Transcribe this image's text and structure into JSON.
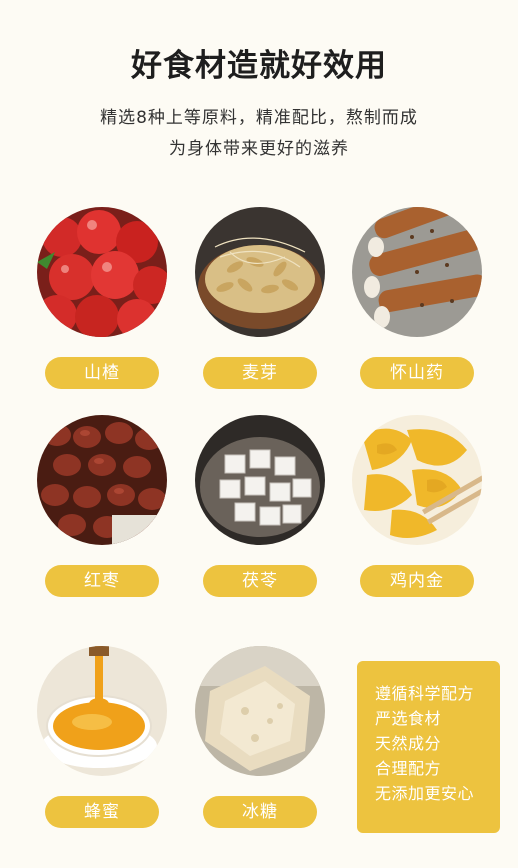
{
  "header": {
    "title": "好食材造就好效用",
    "subtitle_line1": "精选8种上等原料，精准配比，熬制而成",
    "subtitle_line2": "为身体带来更好的滋养"
  },
  "ingredients": [
    {
      "label": "山楂",
      "icon": "hawthorn"
    },
    {
      "label": "麦芽",
      "icon": "malt"
    },
    {
      "label": "怀山药",
      "icon": "chinese-yam"
    },
    {
      "label": "红枣",
      "icon": "red-dates"
    },
    {
      "label": "茯苓",
      "icon": "poria"
    },
    {
      "label": "鸡内金",
      "icon": "chicken-gizzard-lining"
    },
    {
      "label": "蜂蜜",
      "icon": "honey"
    },
    {
      "label": "冰糖",
      "icon": "rock-sugar"
    }
  ],
  "features": [
    "遵循科学配方",
    "严选食材",
    "天然成分",
    "合理配方",
    "无添加更安心"
  ],
  "colors": {
    "accent": "#edc33f",
    "background": "#fdfbf4",
    "title": "#1e1e1e"
  }
}
